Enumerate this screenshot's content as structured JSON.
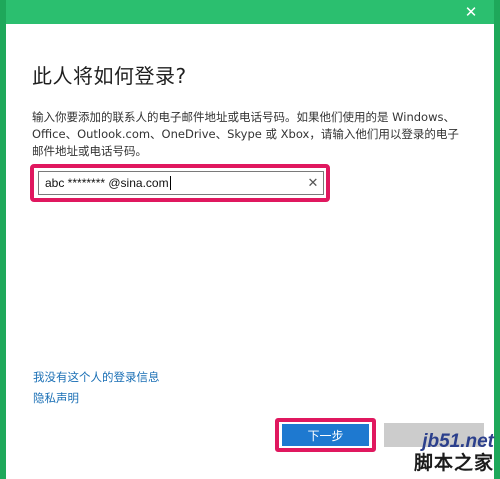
{
  "window": {
    "close_label": "✕"
  },
  "dialog": {
    "title": "此人将如何登录?",
    "description": "输入你要添加的联系人的电子邮件地址或电话号码。如果他们使用的是 Windows、Office、Outlook.com、OneDrive、Skype 或 Xbox，请输入他们用以登录的电子邮件地址或电话号码。",
    "email_value": "abc ******** @sina.com",
    "clear_label": "✕"
  },
  "links": {
    "no_signin_info": "我没有这个人的登录信息",
    "privacy": "隐私声明"
  },
  "buttons": {
    "next_label": "下一步"
  },
  "watermark": {
    "url": "jb51.net",
    "site_name": "脚本之家"
  },
  "colors": {
    "accent_green": "#2bbf6f",
    "highlight_red": "#e0185f",
    "button_blue": "#1e79d0",
    "link_blue": "#1a6fb5"
  }
}
